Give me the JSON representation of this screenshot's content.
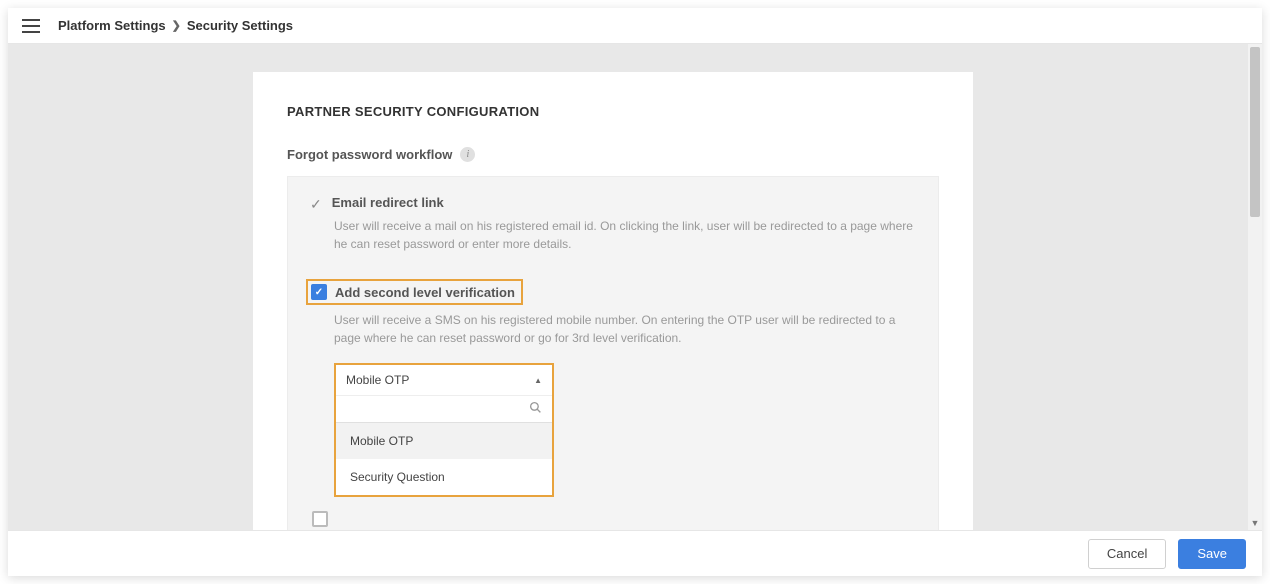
{
  "breadcrumb": {
    "item1": "Platform Settings",
    "item2": "Security Settings"
  },
  "card": {
    "title": "PARTNER SECURITY CONFIGURATION",
    "subtitle": "Forgot password workflow"
  },
  "option1": {
    "title": "Email redirect link",
    "desc": "User will receive a mail on his registered email id. On clicking the link, user will be redirected to a page where he can reset password or enter more details."
  },
  "option2": {
    "title": "Add second level verification",
    "desc": "User will receive a SMS on his registered mobile number. On entering the OTP user will be redirected to a page where he can reset password or go for 3rd level verification."
  },
  "dropdown": {
    "selected": "Mobile OTP",
    "options": [
      "Mobile OTP",
      "Security Question"
    ]
  },
  "footer": {
    "cancel": "Cancel",
    "save": "Save"
  },
  "colors": {
    "accent": "#3b7fe0",
    "highlight_border": "#e8a33d"
  }
}
